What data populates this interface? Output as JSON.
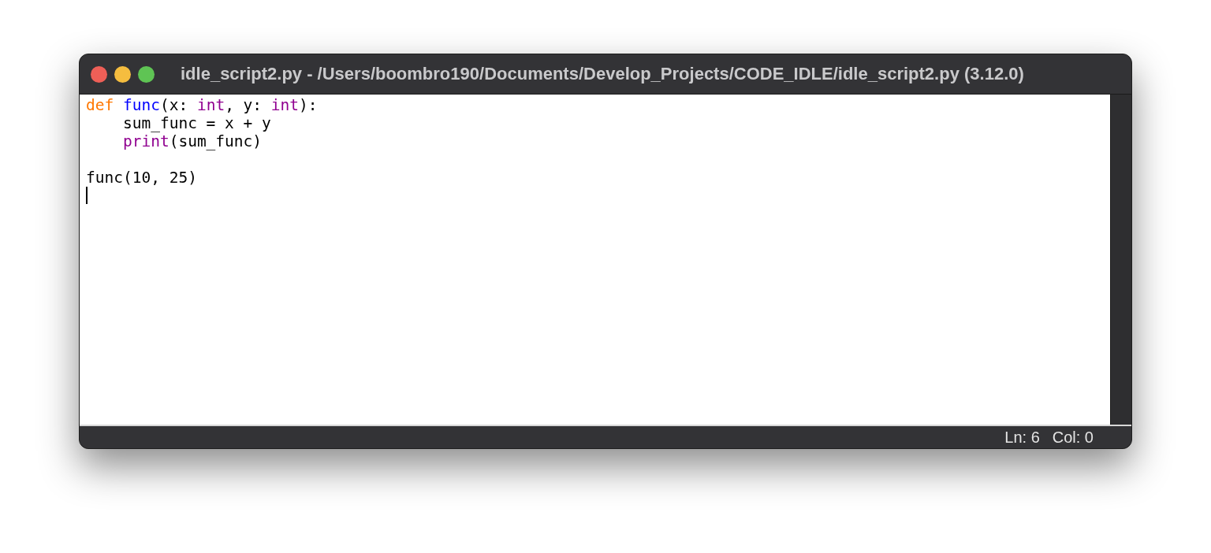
{
  "window": {
    "title": "idle_script2.py - /Users/boombro190/Documents/Develop_Projects/CODE_IDLE/idle_script2.py (3.12.0)"
  },
  "editor": {
    "blocks": [
      [
        {
          "indented": false,
          "tokens": [
            {
              "kind": "keyword",
              "text": "def"
            },
            {
              "kind": "definition",
              "text": " func"
            },
            {
              "kind": "plain",
              "text": "(x: "
            },
            {
              "kind": "builtin",
              "text": "int"
            },
            {
              "kind": "plain",
              "text": ", y: "
            },
            {
              "kind": "builtin",
              "text": "int"
            },
            {
              "kind": "plain",
              "text": "):"
            }
          ]
        },
        {
          "indented": true,
          "tokens": [
            {
              "kind": "plain",
              "text": "sum_func = x + y"
            }
          ]
        },
        {
          "indented": true,
          "tokens": [
            {
              "kind": "builtin",
              "text": "print"
            },
            {
              "kind": "plain",
              "text": "(sum_func)"
            }
          ]
        }
      ],
      [
        {
          "indented": false,
          "tokens": [
            {
              "kind": "plain",
              "text": "func(10, 25)"
            }
          ]
        }
      ]
    ]
  },
  "status_bar": {
    "line": "Ln: 6",
    "column": "Col: 0"
  }
}
